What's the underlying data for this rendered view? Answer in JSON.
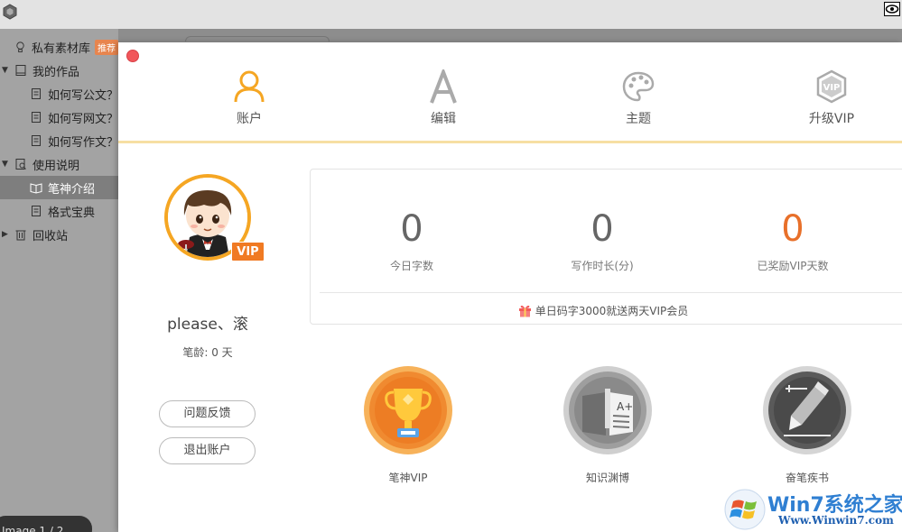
{
  "sidebar": {
    "items": [
      {
        "label": "私有素材库",
        "badge": "推荐",
        "icon": "lightbulb-icon"
      },
      {
        "label": "我的作品",
        "icon": "notebook-icon",
        "expanded": true
      },
      {
        "label": "如何写公文？",
        "icon": "document-icon"
      },
      {
        "label": "如何写网文？",
        "icon": "document-icon"
      },
      {
        "label": "如何写作文？",
        "icon": "document-icon"
      },
      {
        "label": "使用说明",
        "icon": "book-search-icon",
        "expanded": true
      },
      {
        "label": "笔神介绍",
        "icon": "open-book-icon",
        "active": true
      },
      {
        "label": "格式宝典",
        "icon": "document-icon"
      },
      {
        "label": "回收站",
        "icon": "trash-icon"
      }
    ]
  },
  "pager": {
    "text": "Image 1 / 2"
  },
  "dialog": {
    "tabs": [
      {
        "label": "账户",
        "icon": "user-icon",
        "active": true
      },
      {
        "label": "编辑",
        "icon": "letter-a-icon"
      },
      {
        "label": "主题",
        "icon": "palette-icon"
      },
      {
        "label": "升级VIP",
        "icon": "vip-shield-icon"
      }
    ],
    "profile": {
      "vip_tag": "VIP",
      "username": "please、滚",
      "pen_age": "笔龄: 0 天",
      "feedback_button": "问题反馈",
      "logout_button": "退出账户"
    },
    "stats": [
      {
        "value": "0",
        "caption": "今日字数"
      },
      {
        "value": "0",
        "caption": "写作时长(分)"
      },
      {
        "value": "0",
        "caption": "已奖励VIP天数"
      }
    ],
    "promo_text": "单日码字3000就送两天VIP会员",
    "medals": [
      {
        "caption": "笔神VIP",
        "icon": "trophy-medal-icon"
      },
      {
        "caption": "知识渊博",
        "icon": "knowledge-book-medal-icon"
      },
      {
        "caption": "奋笔疾书",
        "icon": "pencil-medal-icon"
      }
    ]
  },
  "watermark": {
    "title": "Win7系统之家",
    "url": "Www.Winwin7.com"
  },
  "colors": {
    "accent": "#f5a623",
    "stat_highlight": "#e8702a",
    "close": "#f1565a",
    "tab_underline": "#f7dfa3"
  }
}
